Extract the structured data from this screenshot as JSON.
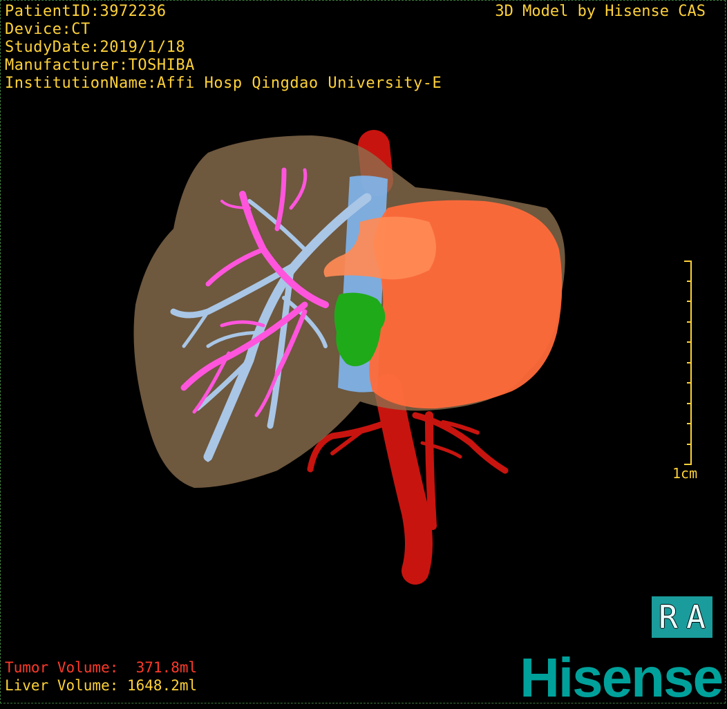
{
  "header": {
    "patient_id": "PatientID:3972236",
    "device": "Device:CT",
    "study_date": "StudyDate:2019/1/18",
    "manufacturer": "Manufacturer:TOSHIBA",
    "institution": "InstitutionName:Affi Hosp Qingdao University-E",
    "model_credit": "3D Model by Hisense CAS"
  },
  "volumes": {
    "tumor": "Tumor Volume:  371.8ml",
    "liver": "Liver Volume: 1648.2ml"
  },
  "scale_bar": {
    "label": "1cm"
  },
  "orientation": {
    "left": "R",
    "right": "A"
  },
  "brand": {
    "logo_text": "Hisense"
  },
  "colors": {
    "text": "#ffd23a",
    "tumor_text": "#ff3a2a",
    "liver": "#9a7a52",
    "tumor": "#ff6a3a",
    "artery": "#c8140f",
    "portal_vein": "#ff55dd",
    "hepatic_vein": "#a9c6e6",
    "ivc": "#6aa8e8",
    "gallbladder": "#1faa1a",
    "brand": "#00a19b"
  }
}
